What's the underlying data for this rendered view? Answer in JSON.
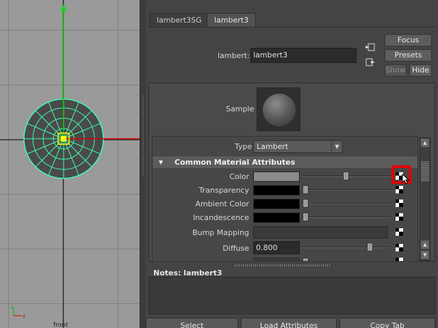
{
  "viewport": {
    "view_label": "front"
  },
  "tabs": [
    {
      "label": "lambert3SG",
      "active": false
    },
    {
      "label": "lambert3",
      "active": true
    }
  ],
  "node": {
    "label": "lambert:",
    "value": "lambert3"
  },
  "side_buttons": {
    "focus": "Focus",
    "presets": "Presets",
    "show": "Show",
    "hide": "Hide"
  },
  "sample_label": "Sample",
  "type": {
    "label": "Type",
    "value": "Lambert"
  },
  "section": {
    "title": "Common Material Attributes",
    "attributes": [
      {
        "label": "Color",
        "swatch": "#8a8a8a",
        "slider": 0.5
      },
      {
        "label": "Transparency",
        "swatch": "#000000",
        "slider": 0
      },
      {
        "label": "Ambient Color",
        "swatch": "#000000",
        "slider": 0
      },
      {
        "label": "Incandescence",
        "swatch": "#000000",
        "slider": 0
      },
      {
        "label": "Bump Mapping",
        "swatch": null,
        "slider": null
      },
      {
        "label": "Diffuse",
        "value": "0.800",
        "slider": 0.8
      }
    ]
  },
  "notes": {
    "label": "Notes:  lambert3"
  },
  "bottom_buttons": {
    "select": "Select",
    "load_attributes": "Load Attributes",
    "copy_tab": "Copy Tab"
  },
  "colors": {
    "highlight": "#e00000",
    "manipulator_green": "#00e000",
    "axis_red": "#e00000",
    "selection_cyan": "#3dffb0"
  }
}
